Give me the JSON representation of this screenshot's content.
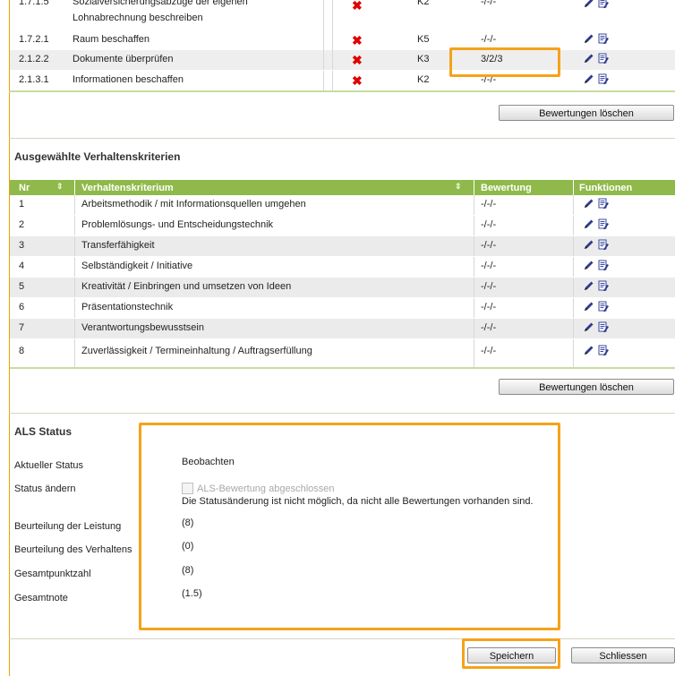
{
  "performance_rows": [
    {
      "nr": "1.7.1.5",
      "title_line1": "Sozialversicherungsabzüge der eigenen",
      "title_line2": "Lohnabrechnung beschreiben",
      "level": "K2",
      "rating": "-/-/-"
    },
    {
      "nr": "1.7.2.1",
      "title": "Raum beschaffen",
      "level": "K5",
      "rating": "-/-/-"
    },
    {
      "nr": "2.1.2.2",
      "title": "Dokumente überprüfen",
      "level": "K3",
      "rating": "3/2/3"
    },
    {
      "nr": "2.1.3.1",
      "title": "Informationen beschaffen",
      "level": "K2",
      "rating": "-/-/-"
    }
  ],
  "delete_ratings_label": "Bewertungen löschen",
  "criteria_section": {
    "title": "Ausgewählte Verhaltenskriterien",
    "headers": {
      "nr": "Nr",
      "criterion": "Verhaltenskriterium",
      "rating": "Bewertung",
      "functions": "Funktionen"
    },
    "rows": [
      {
        "nr": "1",
        "criterion": "Arbeitsmethodik / mit Informationsquellen umgehen",
        "rating": "-/-/-"
      },
      {
        "nr": "2",
        "criterion": "Problemlösungs- und Entscheidungstechnik",
        "rating": "-/-/-"
      },
      {
        "nr": "3",
        "criterion": "Transferfähigkeit",
        "rating": "-/-/-"
      },
      {
        "nr": "4",
        "criterion": "Selbständigkeit / Initiative",
        "rating": "-/-/-"
      },
      {
        "nr": "5",
        "criterion": "Kreativität / Einbringen und umsetzen von Ideen",
        "rating": "-/-/-"
      },
      {
        "nr": "6",
        "criterion": "Präsentationstechnik",
        "rating": "-/-/-"
      },
      {
        "nr": "7",
        "criterion": "Verantwortungsbewusstsein",
        "rating": "-/-/-"
      },
      {
        "nr": "8",
        "criterion": "Zuverlässigkeit / Termineinhaltung / Auftragserfüllung",
        "rating": "-/-/-"
      }
    ]
  },
  "als_status": {
    "title": "ALS Status",
    "current_status_label": "Aktueller Status",
    "current_status_value": "Beobachten",
    "change_status_label": "Status ändern",
    "checkbox_label": "ALS-Bewertung abgeschlossen",
    "checkbox_checked": false,
    "notice": "Die Statusänderung ist nicht möglich, da nicht alle Bewertungen vorhanden sind.",
    "performance_label": "Beurteilung der Leistung",
    "performance_value": "(8)",
    "behavior_label": "Beurteilung des Verhaltens",
    "behavior_value": "(0)",
    "total_points_label": "Gesamtpunktzahl",
    "total_points_value": "(8)",
    "overall_grade_label": "Gesamtnote",
    "overall_grade_value": "(1.5)"
  },
  "buttons": {
    "save": "Speichern",
    "close": "Schliessen"
  },
  "colors": {
    "table_header": "#8fb94a",
    "highlight": "#f5a21b",
    "delete_icon": "#e00000",
    "accent_border": "#f0a000"
  },
  "icons": {
    "delete": "red-x-icon",
    "edit": "pencil-icon",
    "details": "document-icon"
  }
}
